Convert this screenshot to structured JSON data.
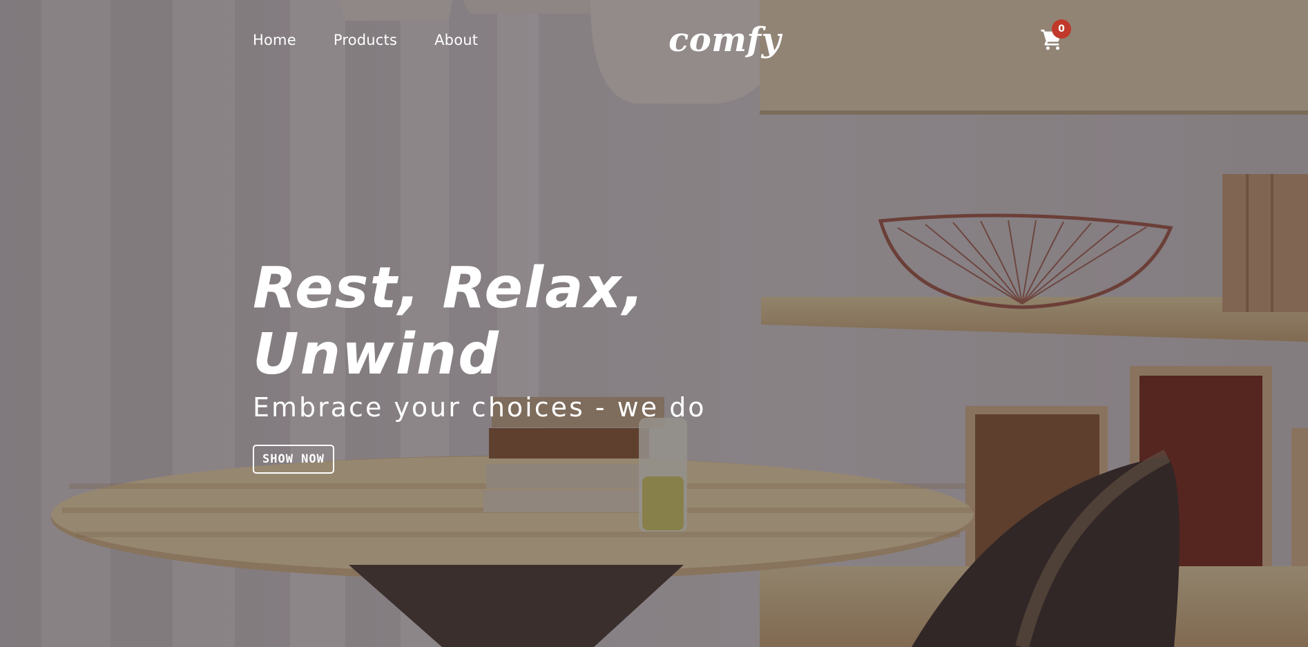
{
  "nav": {
    "links": [
      {
        "label": "Home"
      },
      {
        "label": "Products"
      },
      {
        "label": "About"
      }
    ],
    "logo": "comfy",
    "cart": {
      "count": "0",
      "icon": "cart-icon"
    }
  },
  "banner": {
    "title": "Rest, Relax, Unwind",
    "subtitle": "Embrace your choices - we do",
    "button_label": "SHOW NOW"
  },
  "colors": {
    "overlay": "#281e24",
    "badge": "#c0392b",
    "text": "#ffffff"
  }
}
